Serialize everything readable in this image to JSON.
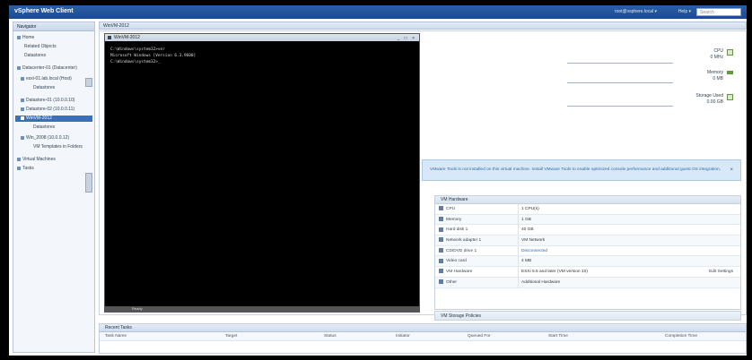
{
  "topbar": {
    "brand": "vSphere Web Client",
    "user": "root@vsphere.local ▾",
    "help": "Help ▾",
    "search_placeholder": "Search"
  },
  "navigator": {
    "header": "Navigator",
    "items": [
      {
        "label": "Home",
        "indent": 0
      },
      {
        "label": "Related Objects",
        "indent": 1
      },
      {
        "label": "Datastores",
        "indent": 1
      },
      {
        "label": "Datacenter-01 (Datacenter)",
        "indent": 0
      },
      {
        "label": "esxi-01.lab.local (Host)",
        "indent": 1
      },
      {
        "label": "Datastores",
        "indent": 2
      },
      {
        "label": "Datastore-01 (10.0.0.10)",
        "indent": 1
      },
      {
        "label": "Datastore-02 (10.0.0.11)",
        "indent": 1
      },
      {
        "label": "WinVM-2012",
        "indent": 1,
        "selected": true
      },
      {
        "label": "Datastores",
        "indent": 2
      },
      {
        "label": "Win_2008 (10.0.0.12)",
        "indent": 1
      },
      {
        "label": "VM Templates in Folders",
        "indent": 2
      },
      {
        "label": "Virtual Machines",
        "indent": 0
      },
      {
        "label": "Tasks",
        "indent": 0
      }
    ]
  },
  "content": {
    "header": "WinVM-2012"
  },
  "console": {
    "title": "WinVM-2012",
    "controls": "_ □ ×",
    "lines": [
      "C:\\Windows\\system32>ver",
      "Microsoft Windows [Version 6.3.9600]",
      "",
      "C:\\Windows\\system32>_"
    ],
    "footer": "Ready"
  },
  "metrics": [
    {
      "label": "CPU",
      "value": "0 MHz"
    },
    {
      "label": "Memory",
      "value": "0 MB"
    },
    {
      "label": "Storage Used",
      "value": "0.00 GB"
    }
  ],
  "banner": {
    "text": "VMware Tools is not installed on this virtual machine. Install VMware Tools to enable optimized console performance and additional guest OS integration.",
    "close": "×"
  },
  "config_panel": {
    "header": "VM Hardware",
    "rows": [
      {
        "label": "CPU",
        "value": "1 CPU(s)",
        "link": false,
        "extra": ""
      },
      {
        "label": "Memory",
        "value": "1 GB",
        "link": false,
        "extra": ""
      },
      {
        "label": "Hard disk 1",
        "value": "40 GB",
        "link": false,
        "extra": ""
      },
      {
        "label": "Network adapter 1",
        "value": "VM Network",
        "link": false,
        "extra": ""
      },
      {
        "label": "CD/DVD drive 1",
        "value": "Disconnected",
        "link": true,
        "extra": ""
      },
      {
        "label": "Video card",
        "value": "4 MB",
        "link": false,
        "extra": ""
      },
      {
        "label": "VM Hardware",
        "value": "ESXi 5.5 and later (VM version 10)",
        "link": false,
        "extra": "Edit Settings"
      },
      {
        "label": "Other",
        "value": "Additional Hardware",
        "link": false,
        "extra": ""
      }
    ]
  },
  "panel2": {
    "header": "VM Storage Policies"
  },
  "tasks": {
    "header": "Recent Tasks",
    "columns": [
      "Task Name",
      "Target",
      "Status",
      "Initiator",
      "Queued For",
      "Start Time",
      "Completion Time"
    ]
  }
}
